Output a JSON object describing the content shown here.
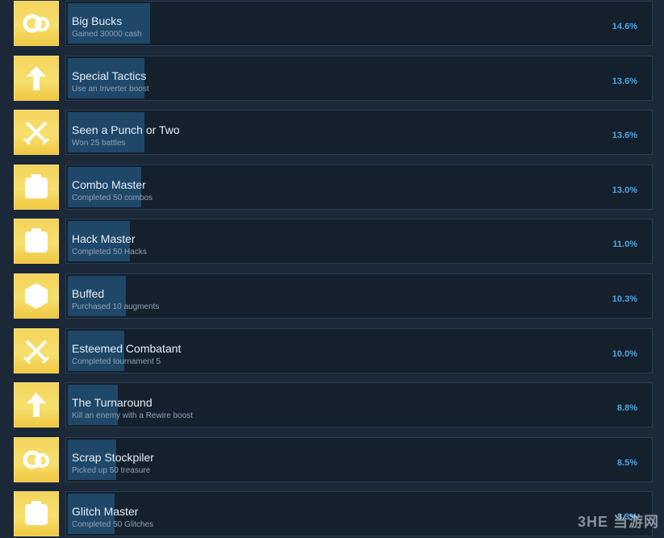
{
  "achievements": [
    {
      "title": "Big Bucks",
      "desc": "Gained 30000 cash",
      "pct": "14.6%",
      "fill": 0.146,
      "icon": "gears-icon"
    },
    {
      "title": "Special Tactics",
      "desc": "Use an Inverter boost",
      "pct": "13.6%",
      "fill": 0.136,
      "icon": "up-arrow-icon"
    },
    {
      "title": "Seen a Punch or Two",
      "desc": "Won 25 battles",
      "pct": "13.6%",
      "fill": 0.136,
      "icon": "crossed-swords-icon"
    },
    {
      "title": "Combo Master",
      "desc": "Completed 50 combos",
      "pct": "13.0%",
      "fill": 0.13,
      "icon": "box-icon"
    },
    {
      "title": "Hack Master",
      "desc": "Completed 50 Hacks",
      "pct": "11.0%",
      "fill": 0.11,
      "icon": "box-icon"
    },
    {
      "title": "Buffed",
      "desc": "Purchased 10 augments",
      "pct": "10.3%",
      "fill": 0.103,
      "icon": "hexagon-icon"
    },
    {
      "title": "Esteemed Combatant",
      "desc": "Completed tournament 5",
      "pct": "10.0%",
      "fill": 0.1,
      "icon": "crossed-swords-icon"
    },
    {
      "title": "The Turnaround",
      "desc": "Kill an enemy with a Rewire boost",
      "pct": "8.8%",
      "fill": 0.088,
      "icon": "up-arrow-icon"
    },
    {
      "title": "Scrap Stockpiler",
      "desc": "Picked up 50 treasure",
      "pct": "8.5%",
      "fill": 0.085,
      "icon": "gears-icon"
    },
    {
      "title": "Glitch Master",
      "desc": "Completed 50 Glitches",
      "pct": "8.3%",
      "fill": 0.083,
      "icon": "box-icon"
    }
  ],
  "watermark": "3HE 当游网",
  "colors": {
    "background": "#1b2838",
    "bar": "#1f4768",
    "percent": "#4aa5e6",
    "icon_bg": "#f4d35a"
  }
}
